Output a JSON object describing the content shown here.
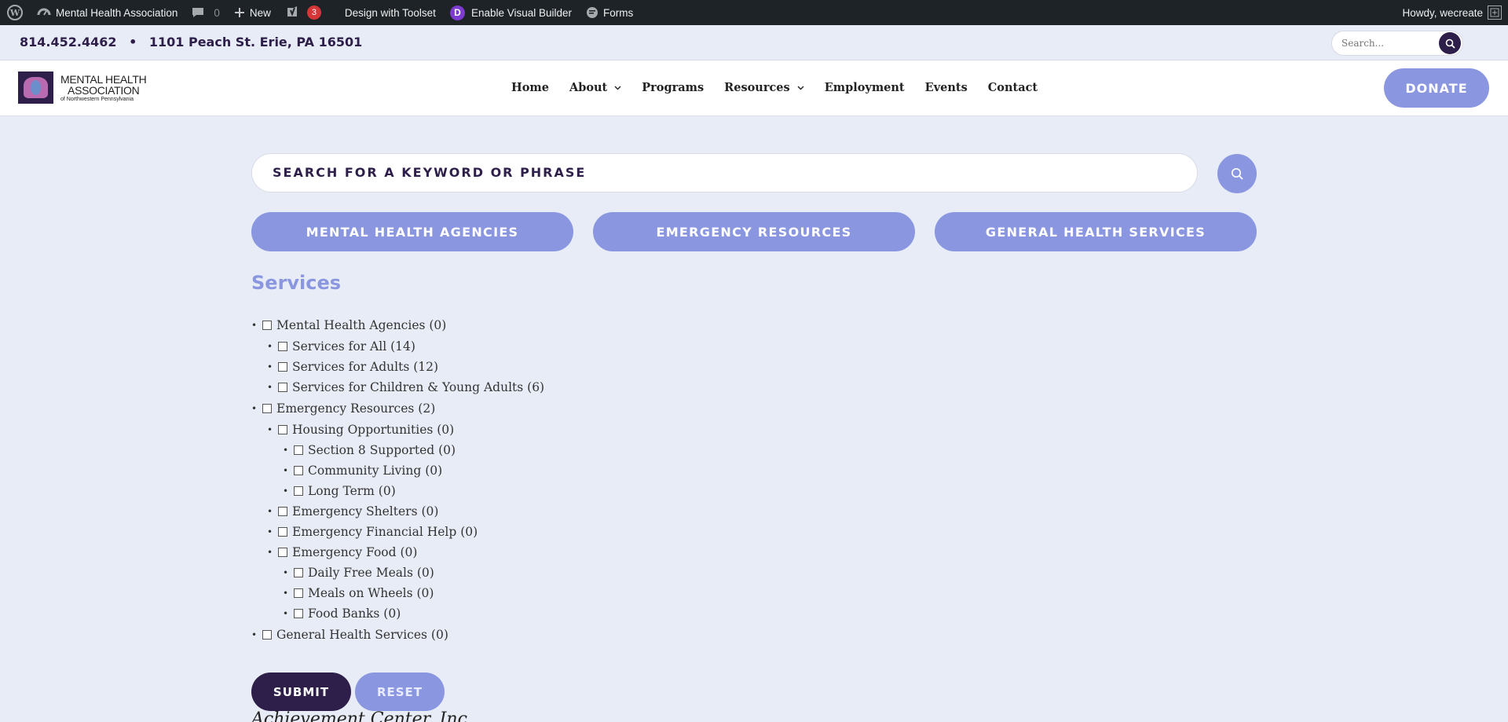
{
  "admin_bar": {
    "site_name": "Mental Health Association",
    "comments_count": "0",
    "new_label": "New",
    "yoast_badge": "3",
    "toolset_label": "Design with Toolset",
    "divi_label": "Enable Visual Builder",
    "forms_label": "Forms",
    "howdy": "Howdy, wecreate"
  },
  "info_bar": {
    "phone": "814.452.4462",
    "separator": "•",
    "address": "1101 Peach St. Erie, PA 16501",
    "search_placeholder": "Search..."
  },
  "header": {
    "logo": {
      "line1": "MENTAL HEALTH",
      "line2": "ASSOCIATION",
      "line3": "of Northwestern Pennsylvania"
    },
    "nav": [
      {
        "label": "Home",
        "dropdown": false
      },
      {
        "label": "About",
        "dropdown": true
      },
      {
        "label": "Programs",
        "dropdown": false
      },
      {
        "label": "Resources",
        "dropdown": true
      },
      {
        "label": "Employment",
        "dropdown": false
      },
      {
        "label": "Events",
        "dropdown": false
      },
      {
        "label": "Contact",
        "dropdown": false
      }
    ],
    "donate_label": "DONATE"
  },
  "main": {
    "search_placeholder": "SEARCH FOR A KEYWORD OR PHRASE",
    "categories": [
      "MENTAL HEALTH AGENCIES",
      "EMERGENCY RESOURCES",
      "GENERAL HEALTH SERVICES"
    ],
    "services_title": "Services",
    "services_tree": [
      {
        "label": "Mental Health Agencies (0)",
        "children": [
          {
            "label": "Services for All (14)"
          },
          {
            "label": "Services for Adults (12)"
          },
          {
            "label": "Services for Children & Young Adults (6)"
          }
        ]
      },
      {
        "label": "Emergency Resources (2)",
        "children": [
          {
            "label": "Housing Opportunities (0)",
            "children": [
              {
                "label": "Section 8 Supported (0)"
              },
              {
                "label": "Community Living (0)"
              },
              {
                "label": "Long Term (0)"
              }
            ]
          },
          {
            "label": "Emergency Shelters (0)"
          },
          {
            "label": "Emergency Financial Help (0)"
          },
          {
            "label": "Emergency Food (0)",
            "children": [
              {
                "label": "Daily Free Meals (0)"
              },
              {
                "label": "Meals on Wheels (0)"
              },
              {
                "label": "Food Banks (0)"
              }
            ]
          }
        ]
      },
      {
        "label": "General Health Services (0)"
      }
    ],
    "submit_label": "SUBMIT",
    "reset_label": "RESET",
    "first_result": "Achievement Center, Inc"
  },
  "colors": {
    "accent": "#8a97e0",
    "dark": "#2e1f4a",
    "page_bg": "#e8ecf6",
    "admin_bar": "#1d2327"
  }
}
